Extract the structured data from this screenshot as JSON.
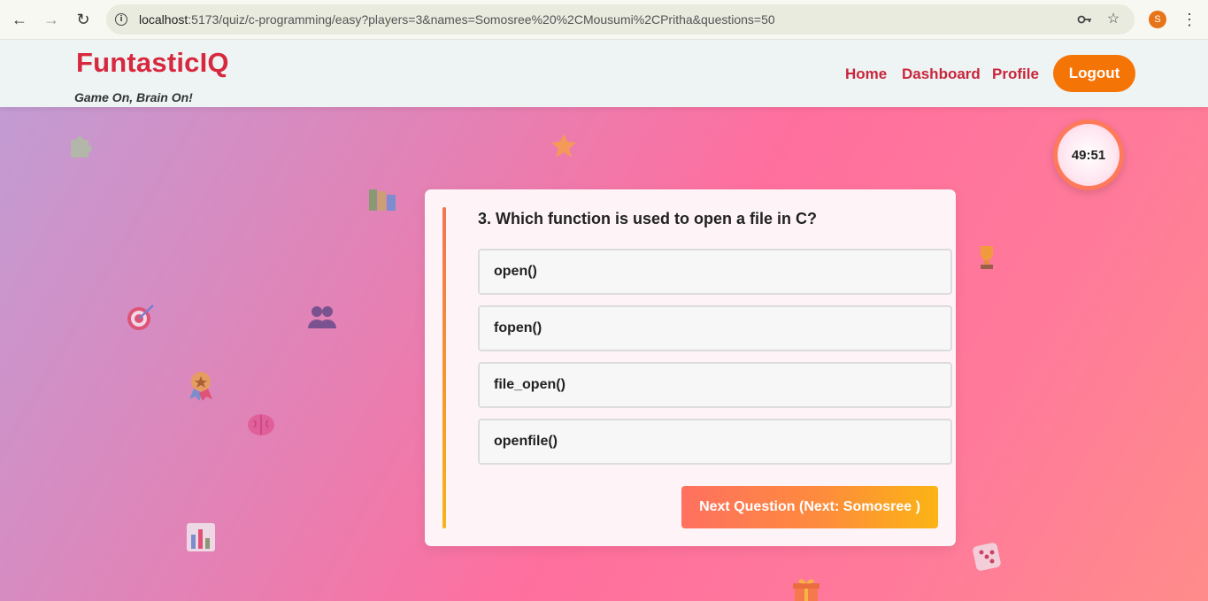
{
  "browser": {
    "url_host": "localhost",
    "url_rest": ":5173/quiz/c-programming/easy?players=3&names=Somosree%20%2CMousumi%2CPritha&questions=50",
    "profile_initial": "S",
    "icons": [
      "back-arrow-icon",
      "forward-arrow-icon",
      "reload-icon",
      "site-info-icon",
      "password-key-icon",
      "bookmark-star-icon",
      "menu-dots-icon"
    ]
  },
  "header": {
    "brand": "FuntasticIQ",
    "tagline": "Game On, Brain On!",
    "nav": [
      "Home",
      "Dashboard",
      "Profile"
    ],
    "logout_label": "Logout"
  },
  "timer": {
    "value": "49:51"
  },
  "quiz": {
    "question": "3. Which function is used to open a file in C?",
    "options": [
      "open()",
      "fopen()",
      "file_open()",
      "openfile()"
    ],
    "next_label": "Next Question (Next: Somosree )"
  },
  "colors": {
    "brand": "#d8283f",
    "accent": "#f57406",
    "nav_link": "#c9253d"
  }
}
